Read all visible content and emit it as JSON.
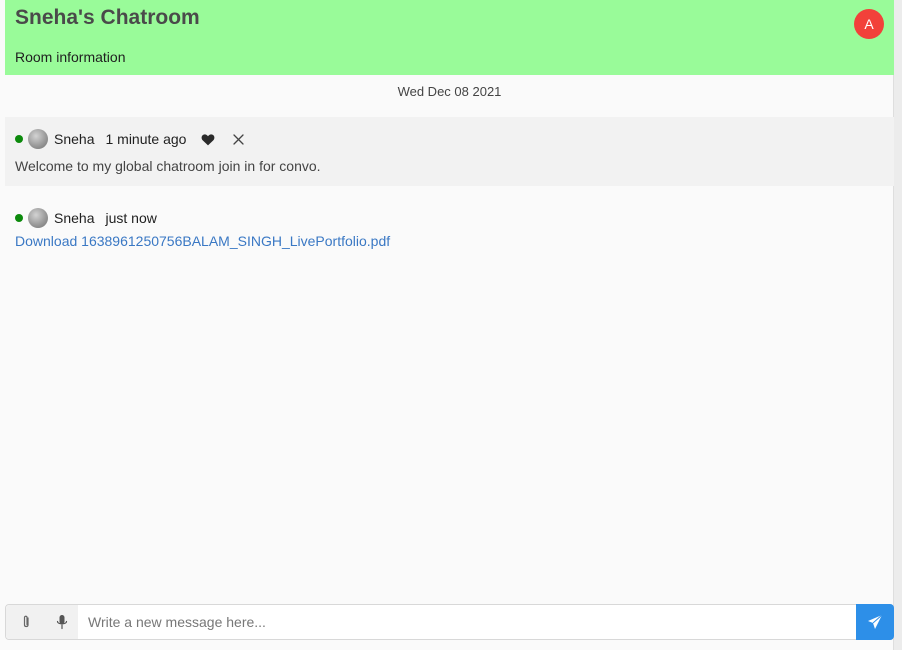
{
  "room": {
    "title": "Sneha's Chatroom",
    "info_label": "Room information",
    "current_user_initial": "A",
    "header_color": "#99fb99"
  },
  "date_separator": "Wed Dec 08 2021",
  "messages": [
    {
      "user": "Sneha",
      "online": true,
      "time": "1 minute ago",
      "text": "Welcome to my global chatroom join in for convo.",
      "actions": [
        "heart-icon",
        "close-icon"
      ]
    },
    {
      "user": "Sneha",
      "online": true,
      "time": "just now",
      "link_text": "Download 1638961250756BALAM_SINGH_LivePortfolio.pdf"
    }
  ],
  "composer": {
    "placeholder": "Write a new message here...",
    "value": "",
    "tools": [
      "paperclip-icon",
      "microphone-icon"
    ],
    "send_icon": "send-icon",
    "send_color": "#2d8fe8"
  }
}
